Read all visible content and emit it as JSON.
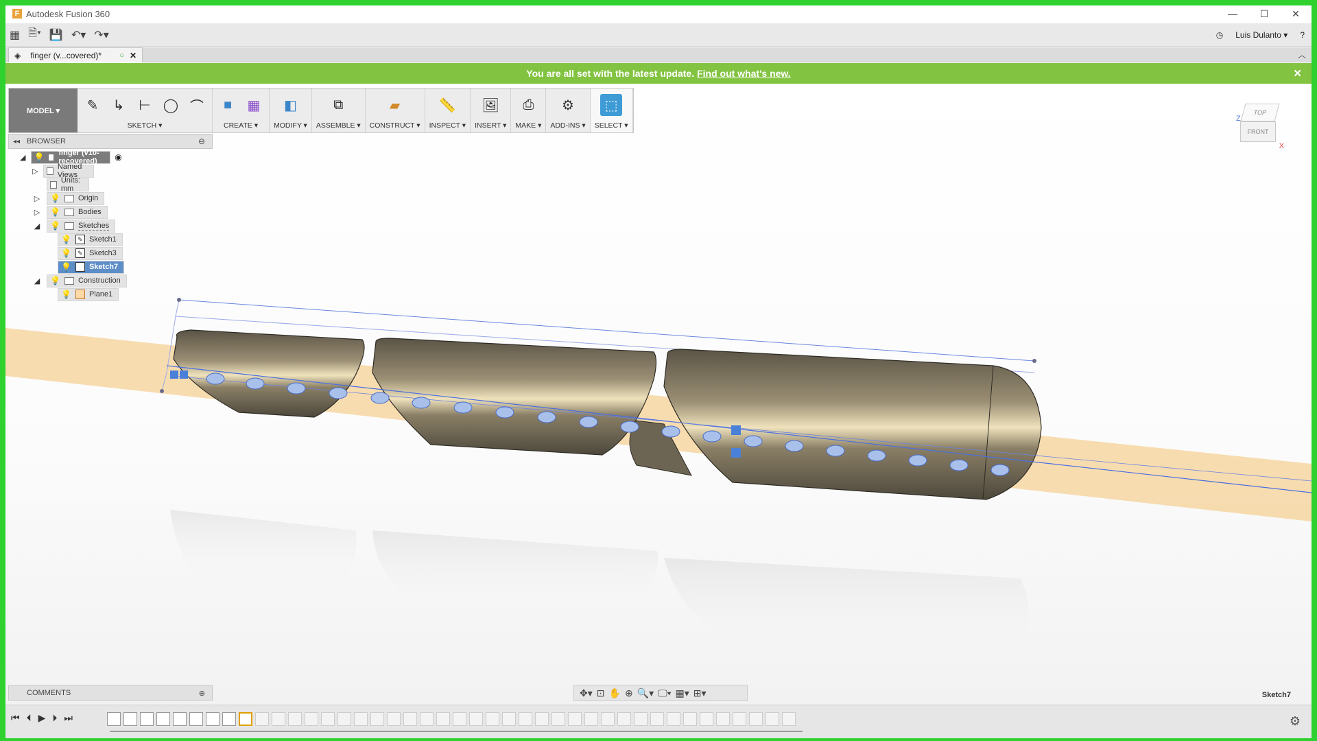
{
  "window": {
    "title": "Autodesk Fusion 360"
  },
  "quick_access": {
    "user": "Luis Dulanto ▾",
    "help": "?"
  },
  "doc_tab": {
    "label": "finger (v...covered)*"
  },
  "banner": {
    "text": "You are all set with the latest update.",
    "link": "Find out what's new.",
    "bg_color": "#82c341"
  },
  "toolbar": {
    "workspace": "MODEL ▾",
    "groups": [
      {
        "label": "SKETCH ▾"
      },
      {
        "label": "CREATE ▾"
      },
      {
        "label": "MODIFY ▾"
      },
      {
        "label": "ASSEMBLE ▾"
      },
      {
        "label": "CONSTRUCT ▾"
      },
      {
        "label": "INSPECT ▾"
      },
      {
        "label": "INSERT ▾"
      },
      {
        "label": "MAKE ▾"
      },
      {
        "label": "ADD-INS ▾"
      },
      {
        "label": "SELECT ▾"
      }
    ]
  },
  "browser": {
    "title": "BROWSER",
    "items": [
      {
        "label": "finger (v10-recovered)"
      },
      {
        "label": "Named Views"
      },
      {
        "label": "Units: mm"
      },
      {
        "label": "Origin"
      },
      {
        "label": "Bodies"
      },
      {
        "label": "Sketches"
      },
      {
        "label": "Sketch1"
      },
      {
        "label": "Sketch3"
      },
      {
        "label": "Sketch7"
      },
      {
        "label": "Construction"
      },
      {
        "label": "Plane1"
      }
    ]
  },
  "viewcube": {
    "top": "TOP",
    "front": "FRONT",
    "z": "Z",
    "x": "X"
  },
  "comments": {
    "title": "COMMENTS"
  },
  "status": {
    "active_sketch": "Sketch7"
  }
}
